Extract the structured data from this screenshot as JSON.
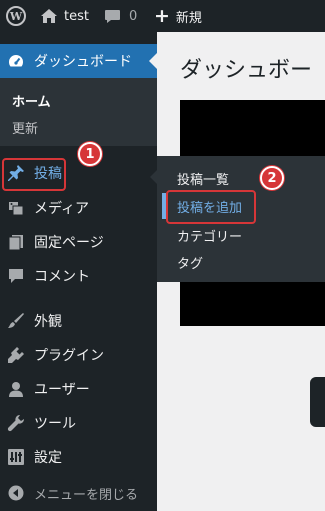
{
  "admin_bar": {
    "site_name": "test",
    "comments_count": "0",
    "new_label": "新規"
  },
  "sidebar": {
    "dashboard_label": "ダッシュボード",
    "dashboard_submenu": [
      "ホーム",
      "更新"
    ],
    "items": [
      {
        "label": "投稿",
        "icon": "pin-icon"
      },
      {
        "label": "メディア",
        "icon": "media-icon"
      },
      {
        "label": "固定ページ",
        "icon": "page-icon"
      },
      {
        "label": "コメント",
        "icon": "comment-icon"
      },
      {
        "label": "外観",
        "icon": "paintbrush-icon"
      },
      {
        "label": "プラグイン",
        "icon": "plugin-icon"
      },
      {
        "label": "ユーザー",
        "icon": "user-icon"
      },
      {
        "label": "ツール",
        "icon": "wrench-icon"
      },
      {
        "label": "設定",
        "icon": "settings-icon"
      }
    ],
    "collapse_label": "メニューを閉じる"
  },
  "flyout": {
    "items": [
      "投稿一覧",
      "投稿を追加",
      "カテゴリー",
      "タグ"
    ]
  },
  "annotations": {
    "badge_1": "1",
    "badge_2": "2"
  },
  "main": {
    "page_title": "ダッシュボー"
  },
  "colors": {
    "admin_bg": "#1d2327",
    "accent": "#2271b1",
    "highlight_text": "#72aee6",
    "annotation_red": "#d63638"
  }
}
